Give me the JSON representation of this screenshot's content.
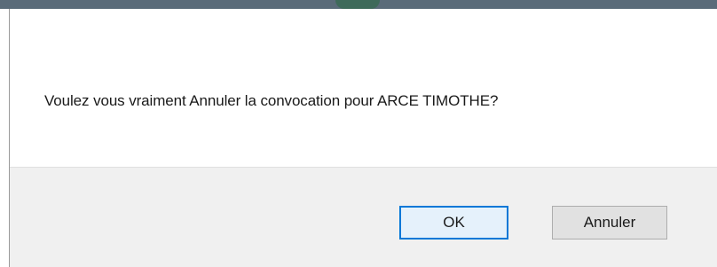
{
  "dialog": {
    "message": "Voulez vous vraiment Annuler la convocation pour ARCE TIMOTHE?",
    "ok_label": "OK",
    "cancel_label": "Annuler"
  },
  "colors": {
    "primary_button_border": "#0078d7",
    "footer_background": "#f0f0f0"
  }
}
